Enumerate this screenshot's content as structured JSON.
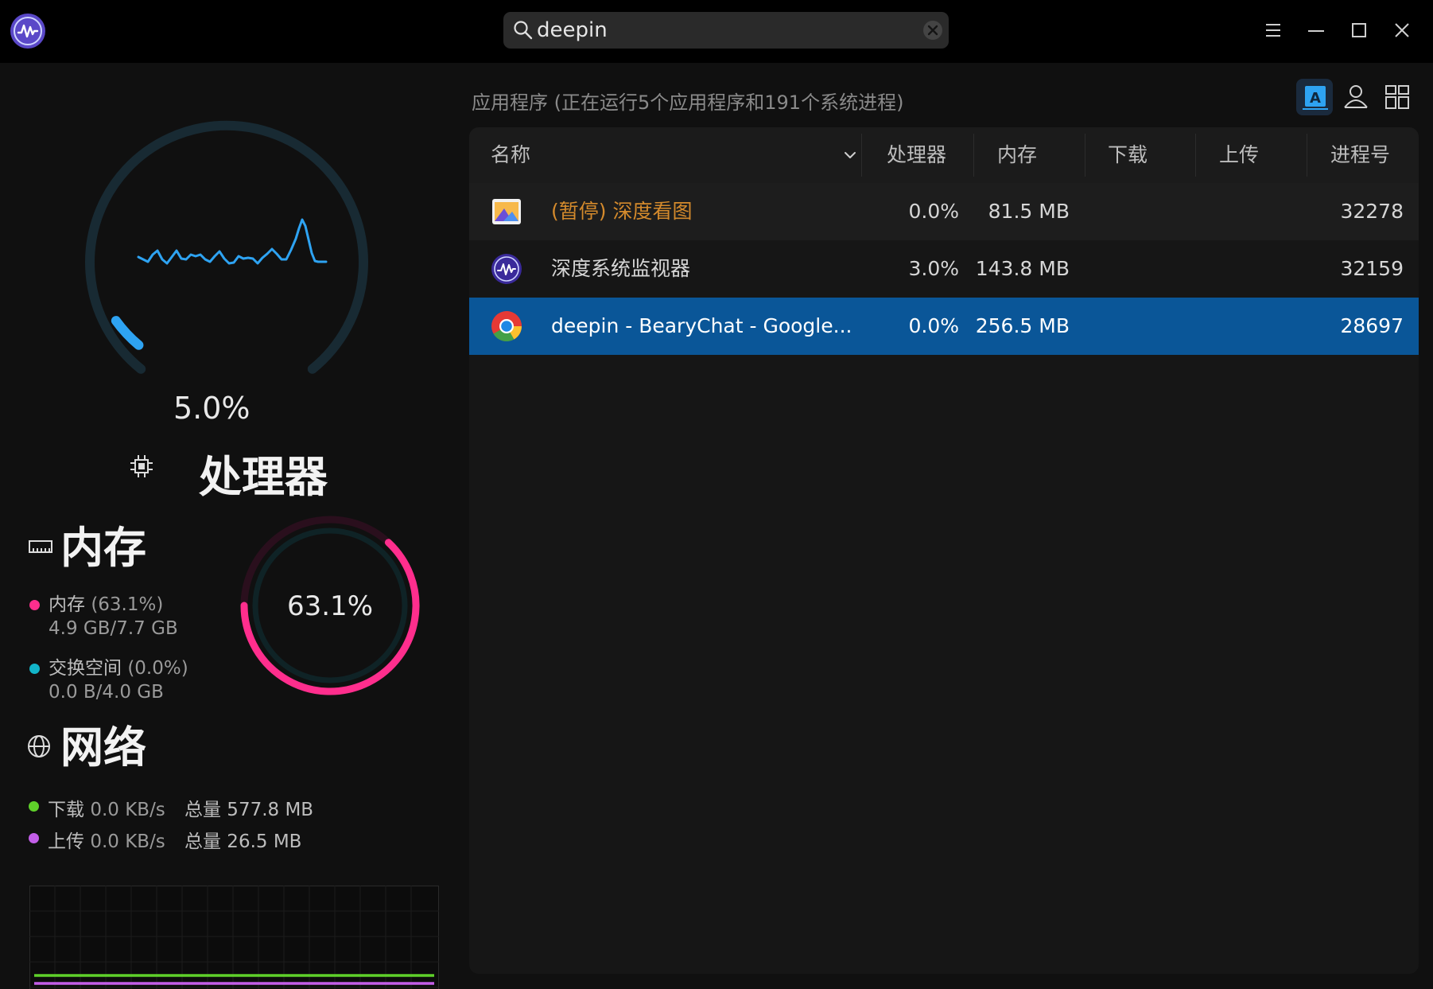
{
  "titlebar": {
    "app_icon": "system-monitor-icon",
    "search": {
      "value": "deepin",
      "placeholder": ""
    },
    "buttons": {
      "menu": "menu-icon",
      "minimize": "minimize-icon",
      "maximize": "maximize-icon",
      "close": "close-icon"
    }
  },
  "cpu": {
    "value": "5.0%",
    "fraction": 0.05,
    "label": "处理器"
  },
  "memory": {
    "title": "内存",
    "ring_value": "63.1%",
    "ring_fraction": 0.631,
    "mem_label": "内存",
    "mem_percent": "(63.1%)",
    "mem_detail": "4.9 GB/7.7 GB",
    "swap_label": "交换空间",
    "swap_percent": "(0.0%)",
    "swap_detail": "0.0 B/4.0 GB",
    "mem_color": "#ff2e8d",
    "swap_color": "#12b5c9"
  },
  "network": {
    "title": "网络",
    "download_label": "下载",
    "download_rate": "0.0 KB/s",
    "download_total": "总量 577.8 MB",
    "upload_label": "上传",
    "upload_rate": "0.0 KB/s",
    "upload_total": "总量 26.5 MB",
    "download_color": "#5fd12a",
    "upload_color": "#c35ee8"
  },
  "process_panel": {
    "summary": "应用程序 (正在运行5个应用程序和191个系统进程)",
    "view_buttons": [
      "app-view-icon",
      "user-view-icon",
      "all-processes-icon"
    ],
    "columns": {
      "name": "名称",
      "cpu": "处理器",
      "memory": "内存",
      "download": "下载",
      "upload": "上传",
      "pid": "进程号"
    },
    "rows": [
      {
        "name": "(暂停) 深度看图",
        "cpu": "0.0%",
        "memory": "81.5 MB",
        "download": "",
        "upload": "",
        "pid": "32278",
        "icon": "image-viewer-icon",
        "state": "paused"
      },
      {
        "name": "深度系统监视器",
        "cpu": "3.0%",
        "memory": "143.8 MB",
        "download": "",
        "upload": "",
        "pid": "32159",
        "icon": "system-monitor-icon",
        "state": "normal"
      },
      {
        "name": "deepin - BearyChat - Google...",
        "cpu": "0.0%",
        "memory": "256.5 MB",
        "download": "",
        "upload": "",
        "pid": "28697",
        "icon": "chrome-icon",
        "state": "selected"
      }
    ]
  },
  "colors": {
    "accent": "#0a5698",
    "paused_text": "#d48a2c",
    "cpu_ring": "#2ea3f2"
  }
}
